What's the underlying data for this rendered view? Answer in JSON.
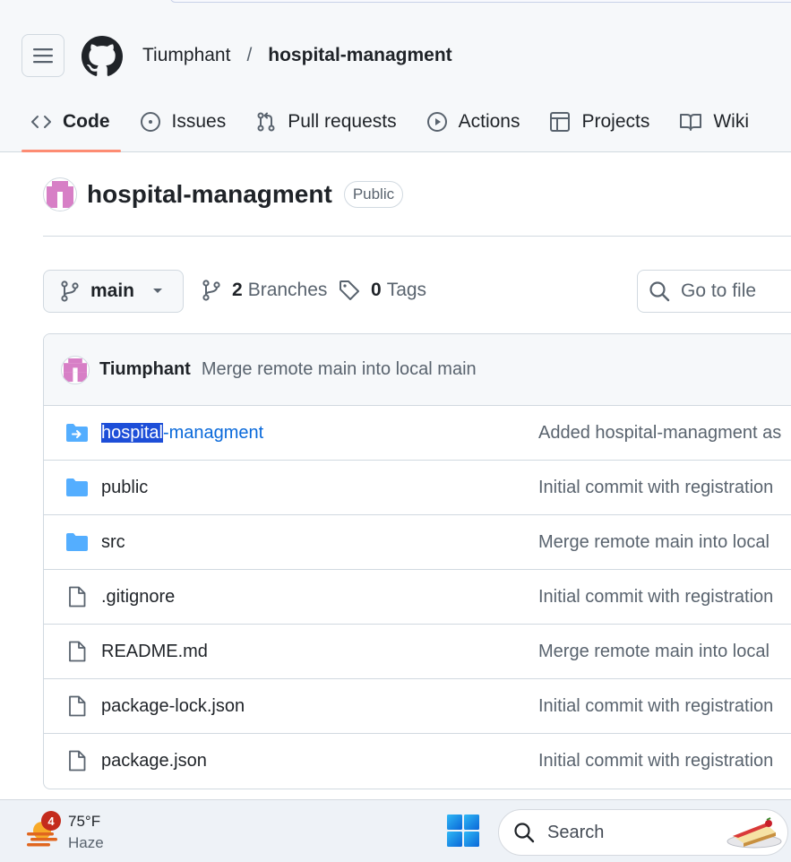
{
  "header": {
    "owner": "Tiumphant",
    "separator": "/",
    "repo": "hospital-managment",
    "tabs": [
      {
        "label": "Code",
        "icon": "code-icon"
      },
      {
        "label": "Issues",
        "icon": "issue-opened-icon"
      },
      {
        "label": "Pull requests",
        "icon": "git-pull-request-icon"
      },
      {
        "label": "Actions",
        "icon": "play-icon"
      },
      {
        "label": "Projects",
        "icon": "table-icon"
      },
      {
        "label": "Wiki",
        "icon": "book-icon"
      }
    ],
    "active_tab": "Code"
  },
  "repo": {
    "title": "hospital-managment",
    "visibility": "Public"
  },
  "toolbar": {
    "branch": "main",
    "branches_count": "2",
    "branches_label": "Branches",
    "tags_count": "0",
    "tags_label": "Tags",
    "goto_placeholder": "Go to file"
  },
  "latest_commit": {
    "author": "Tiumphant",
    "message": "Merge remote main into local main"
  },
  "files": [
    {
      "name_selected": "hospital",
      "name_rest": "-managment",
      "type": "submodule",
      "message": "Added hospital-managment as"
    },
    {
      "name": "public",
      "type": "folder",
      "message": "Initial commit with registration"
    },
    {
      "name": "src",
      "type": "folder",
      "message": "Merge remote main into local"
    },
    {
      "name": ".gitignore",
      "type": "file",
      "message": "Initial commit with registration"
    },
    {
      "name": "README.md",
      "type": "file",
      "message": "Merge remote main into local"
    },
    {
      "name": "package-lock.json",
      "type": "file",
      "message": "Initial commit with registration"
    },
    {
      "name": "package.json",
      "type": "file",
      "message": "Initial commit with registration"
    }
  ],
  "taskbar": {
    "notification_count": "4",
    "temperature": "75°F",
    "condition": "Haze",
    "search_label": "Search"
  },
  "colors": {
    "accent_underline": "#fd8c73",
    "link": "#0969da",
    "folder": "#54aeff",
    "selection": "#1d4ed8"
  }
}
